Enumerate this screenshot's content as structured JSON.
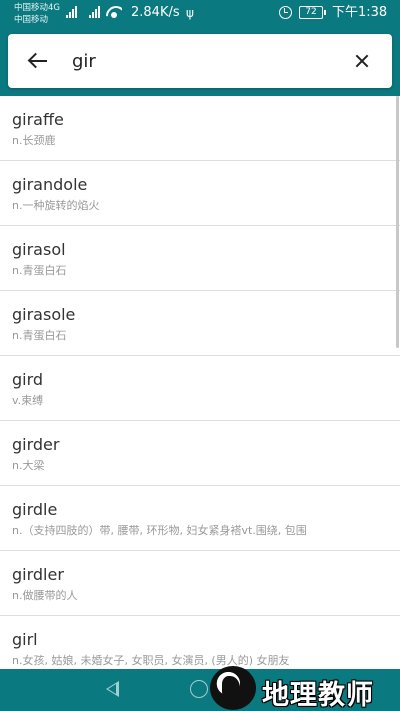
{
  "status_bar": {
    "carrier_1": "中国移动4G",
    "carrier_2": "中国移动",
    "net_speed": "2.84K/s",
    "battery": "72",
    "time": "下午1:38"
  },
  "search": {
    "query": "gir"
  },
  "results": [
    {
      "word": "giraffe",
      "definition": "n.长颈鹿"
    },
    {
      "word": "girandole",
      "definition": "n.一种旋转的焰火"
    },
    {
      "word": "girasol",
      "definition": "n.青蛋白石"
    },
    {
      "word": "girasole",
      "definition": "n.青蛋白石"
    },
    {
      "word": "gird",
      "definition": "v.束缚"
    },
    {
      "word": "girder",
      "definition": "n.大梁"
    },
    {
      "word": "girdle",
      "definition": "n.（支持四肢的）带, 腰带, 环形物, 妇女紧身褡vt.围绕, 包围"
    },
    {
      "word": "girdler",
      "definition": "n.做腰带的人"
    },
    {
      "word": "girl",
      "definition": "n.女孩, 姑娘, 未婚女子, 女职员, 女演员, (男人的) 女朋友"
    }
  ],
  "watermark": {
    "text": "地理教师"
  },
  "colors": {
    "header": "#0b7a80",
    "word_text": "#333333",
    "definition_text": "#999999"
  },
  "icons": {
    "back": "arrow-left-icon",
    "clear": "close-icon",
    "nav_back": "triangle-back-icon",
    "nav_home": "circle-home-icon"
  }
}
